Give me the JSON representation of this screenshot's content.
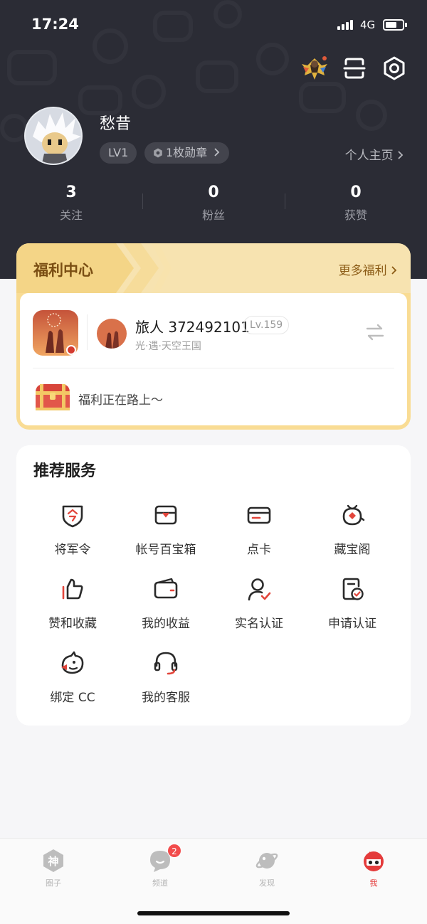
{
  "status": {
    "time": "17:24",
    "network": "4G"
  },
  "profile": {
    "name": "愁昔",
    "level": "LV1",
    "medals": "1枚勋章",
    "homepage_link": "个人主页"
  },
  "stats": [
    {
      "value": "3",
      "label": "关注"
    },
    {
      "value": "0",
      "label": "粉丝"
    },
    {
      "value": "0",
      "label": "获赞"
    }
  ],
  "welfare": {
    "title": "福利中心",
    "more": "更多福利",
    "game_name": "旅人 372492101",
    "game_level": "Lv.159",
    "game_server": "光·遇·天空王国",
    "status": "福利正在路上～"
  },
  "services": {
    "title": "推荐服务",
    "items": [
      {
        "label": "将军令",
        "icon": "shield-token-icon"
      },
      {
        "label": "帐号百宝箱",
        "icon": "treasure-box-icon"
      },
      {
        "label": "点卡",
        "icon": "card-icon"
      },
      {
        "label": "藏宝阁",
        "icon": "treasure-pavilion-icon"
      },
      {
        "label": "赞和收藏",
        "icon": "thumbs-up-icon"
      },
      {
        "label": "我的收益",
        "icon": "wallet-icon"
      },
      {
        "label": "实名认证",
        "icon": "verified-user-icon"
      },
      {
        "label": "申请认证",
        "icon": "certify-document-icon"
      },
      {
        "label": "绑定 CC",
        "icon": "cc-bird-icon"
      },
      {
        "label": "我的客服",
        "icon": "headset-icon"
      }
    ]
  },
  "tabs": [
    {
      "label": "圈子",
      "icon": "circle-god-icon"
    },
    {
      "label": "频道",
      "icon": "channel-chat-icon",
      "badge": "2"
    },
    {
      "label": "发现",
      "icon": "planet-discover-icon"
    },
    {
      "label": "我",
      "icon": "me-ninja-icon",
      "active": true
    }
  ],
  "colors": {
    "hero_bg": "#2b2c35",
    "welfare_gold": "#f9dc94",
    "accent_red": "#e43b3b"
  }
}
